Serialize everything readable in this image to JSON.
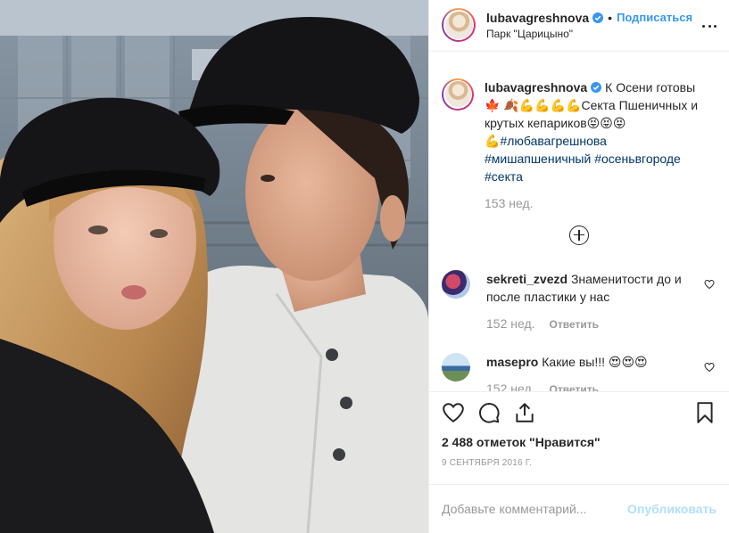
{
  "post": {
    "username": "lubavagreshnova",
    "follow_label": "Подписаться",
    "dot": "•",
    "location": "Парк \"Царицыно\""
  },
  "caption": {
    "username": "lubavagreshnova",
    "text_1": "К Осени готовы🍁",
    "text_2": "🍂💪💪💪💪Секта Пшеничных и крутых кепариков😝😝😝",
    "text_3": "💪",
    "hashtags": [
      "#любавагрешнова",
      "#мишапшеничный",
      "#осеньвгороде",
      "#секта"
    ],
    "time": "153 нед."
  },
  "comments": [
    {
      "username": "sekreti_zvezd",
      "text": "Знаменитости до и после пластики у нас",
      "time": "152 нед.",
      "reply_label": "Ответить"
    },
    {
      "username": "masepro",
      "text": "Какие вы!!! 😍😍😍",
      "time": "152 нед.",
      "reply_label": "Ответить"
    }
  ],
  "likes_text": "2 488 отметок \"Нравится\"",
  "date_text": "9 СЕНТЯБРЯ 2016 Г.",
  "add_comment": {
    "placeholder": "Добавьте комментарий...",
    "publish_label": "Опубликовать"
  },
  "colors": {
    "link": "#3897f0",
    "hashtag": "#003569",
    "muted": "#999999",
    "publish_disabled": "#b2dffc"
  }
}
